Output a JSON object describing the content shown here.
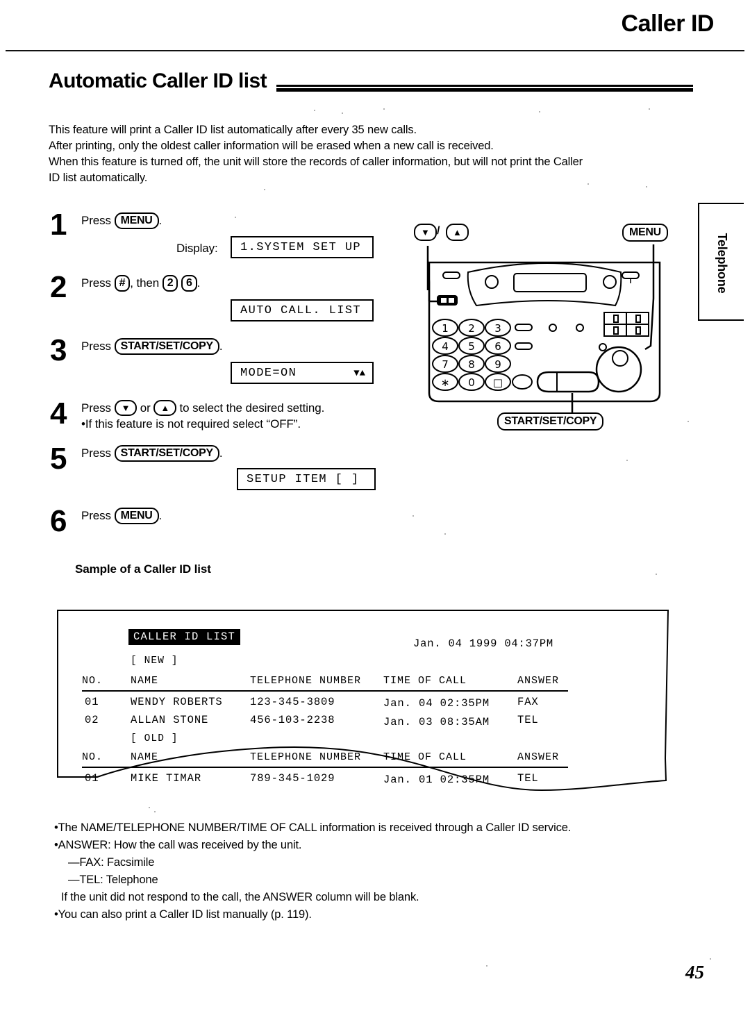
{
  "header": {
    "title": "Caller ID",
    "page_number": "45"
  },
  "section": {
    "heading": "Automatic Caller ID list"
  },
  "intro": {
    "line1": "This feature will print a Caller ID list automatically after every 35 new calls.",
    "line2": "After printing, only the oldest caller information will be erased when a new call is received.",
    "line3": "When this feature is turned off, the unit will store the records of caller information, but will not print the Caller",
    "line4": "ID list automatically."
  },
  "side_tab": {
    "label": "Telephone"
  },
  "steps": [
    {
      "number": "1",
      "press_word": "Press",
      "key": "MENU",
      "trailing": ".",
      "display_label": "Display:",
      "display_value": "1.SYSTEM SET UP"
    },
    {
      "number": "2",
      "press_word": "Press",
      "key": "#",
      "then_word": ", then",
      "key2": "2",
      "key3": "6",
      "trailing": ".",
      "display_value": "AUTO CALL. LIST"
    },
    {
      "number": "3",
      "press_word": "Press",
      "key": "START/SET/COPY",
      "trailing": ".",
      "display_value": "MODE=ON",
      "display_arrows": "▼▲"
    },
    {
      "number": "4",
      "press_word": "Press",
      "key_down": "▼",
      "or_word": "or",
      "key_up": "▲",
      "tail_text": "to select the desired setting.",
      "note": "•If this feature is not required select “OFF”."
    },
    {
      "number": "5",
      "press_word": "Press",
      "key": "START/SET/COPY",
      "trailing": ".",
      "display_value": "SETUP ITEM [   ]"
    },
    {
      "number": "6",
      "press_word": "Press",
      "key": "MENU",
      "trailing": "."
    }
  ],
  "diagram": {
    "callout_down": "▼",
    "callout_slash": "/",
    "callout_up": "▲",
    "callout_menu": "MENU",
    "callout_start": "START/SET/COPY",
    "keypad": [
      "1",
      "2",
      "3",
      "4",
      "5",
      "6",
      "7",
      "8",
      "9",
      "∗",
      "0",
      "□"
    ]
  },
  "sample": {
    "heading": "Sample of a Caller ID list",
    "list_title": "CALLER ID LIST",
    "datetime": "Jan. 04 1999 04:37PM",
    "group_new": "[ NEW ]",
    "group_old": "[ OLD ]",
    "columns": [
      "NO.",
      "NAME",
      "TELEPHONE NUMBER",
      "TIME OF CALL",
      "ANSWER"
    ],
    "new_rows": [
      {
        "no": "01",
        "name": "WENDY ROBERTS",
        "phone": "123-345-3809",
        "time": "Jan. 04 02:35PM",
        "answer": "FAX"
      },
      {
        "no": "02",
        "name": "ALLAN STONE",
        "phone": "456-103-2238",
        "time": "Jan. 03 08:35AM",
        "answer": "TEL"
      }
    ],
    "old_rows": [
      {
        "no": "01",
        "name": "MIKE TIMAR",
        "phone": "789-345-1029",
        "time": "Jan. 01 02:35PM",
        "answer": "TEL"
      }
    ]
  },
  "footnotes": {
    "line1": "•The NAME/TELEPHONE NUMBER/TIME OF CALL information is received through a Caller ID service.",
    "line2": "•ANSWER:  How the call was received by the unit.",
    "line3": "—FAX:  Facsimile",
    "line4": "—TEL:  Telephone",
    "line5": "If the unit did not respond to the call, the ANSWER column will be blank.",
    "line6": "•You can also print a Caller ID list manually (p. 119)."
  }
}
